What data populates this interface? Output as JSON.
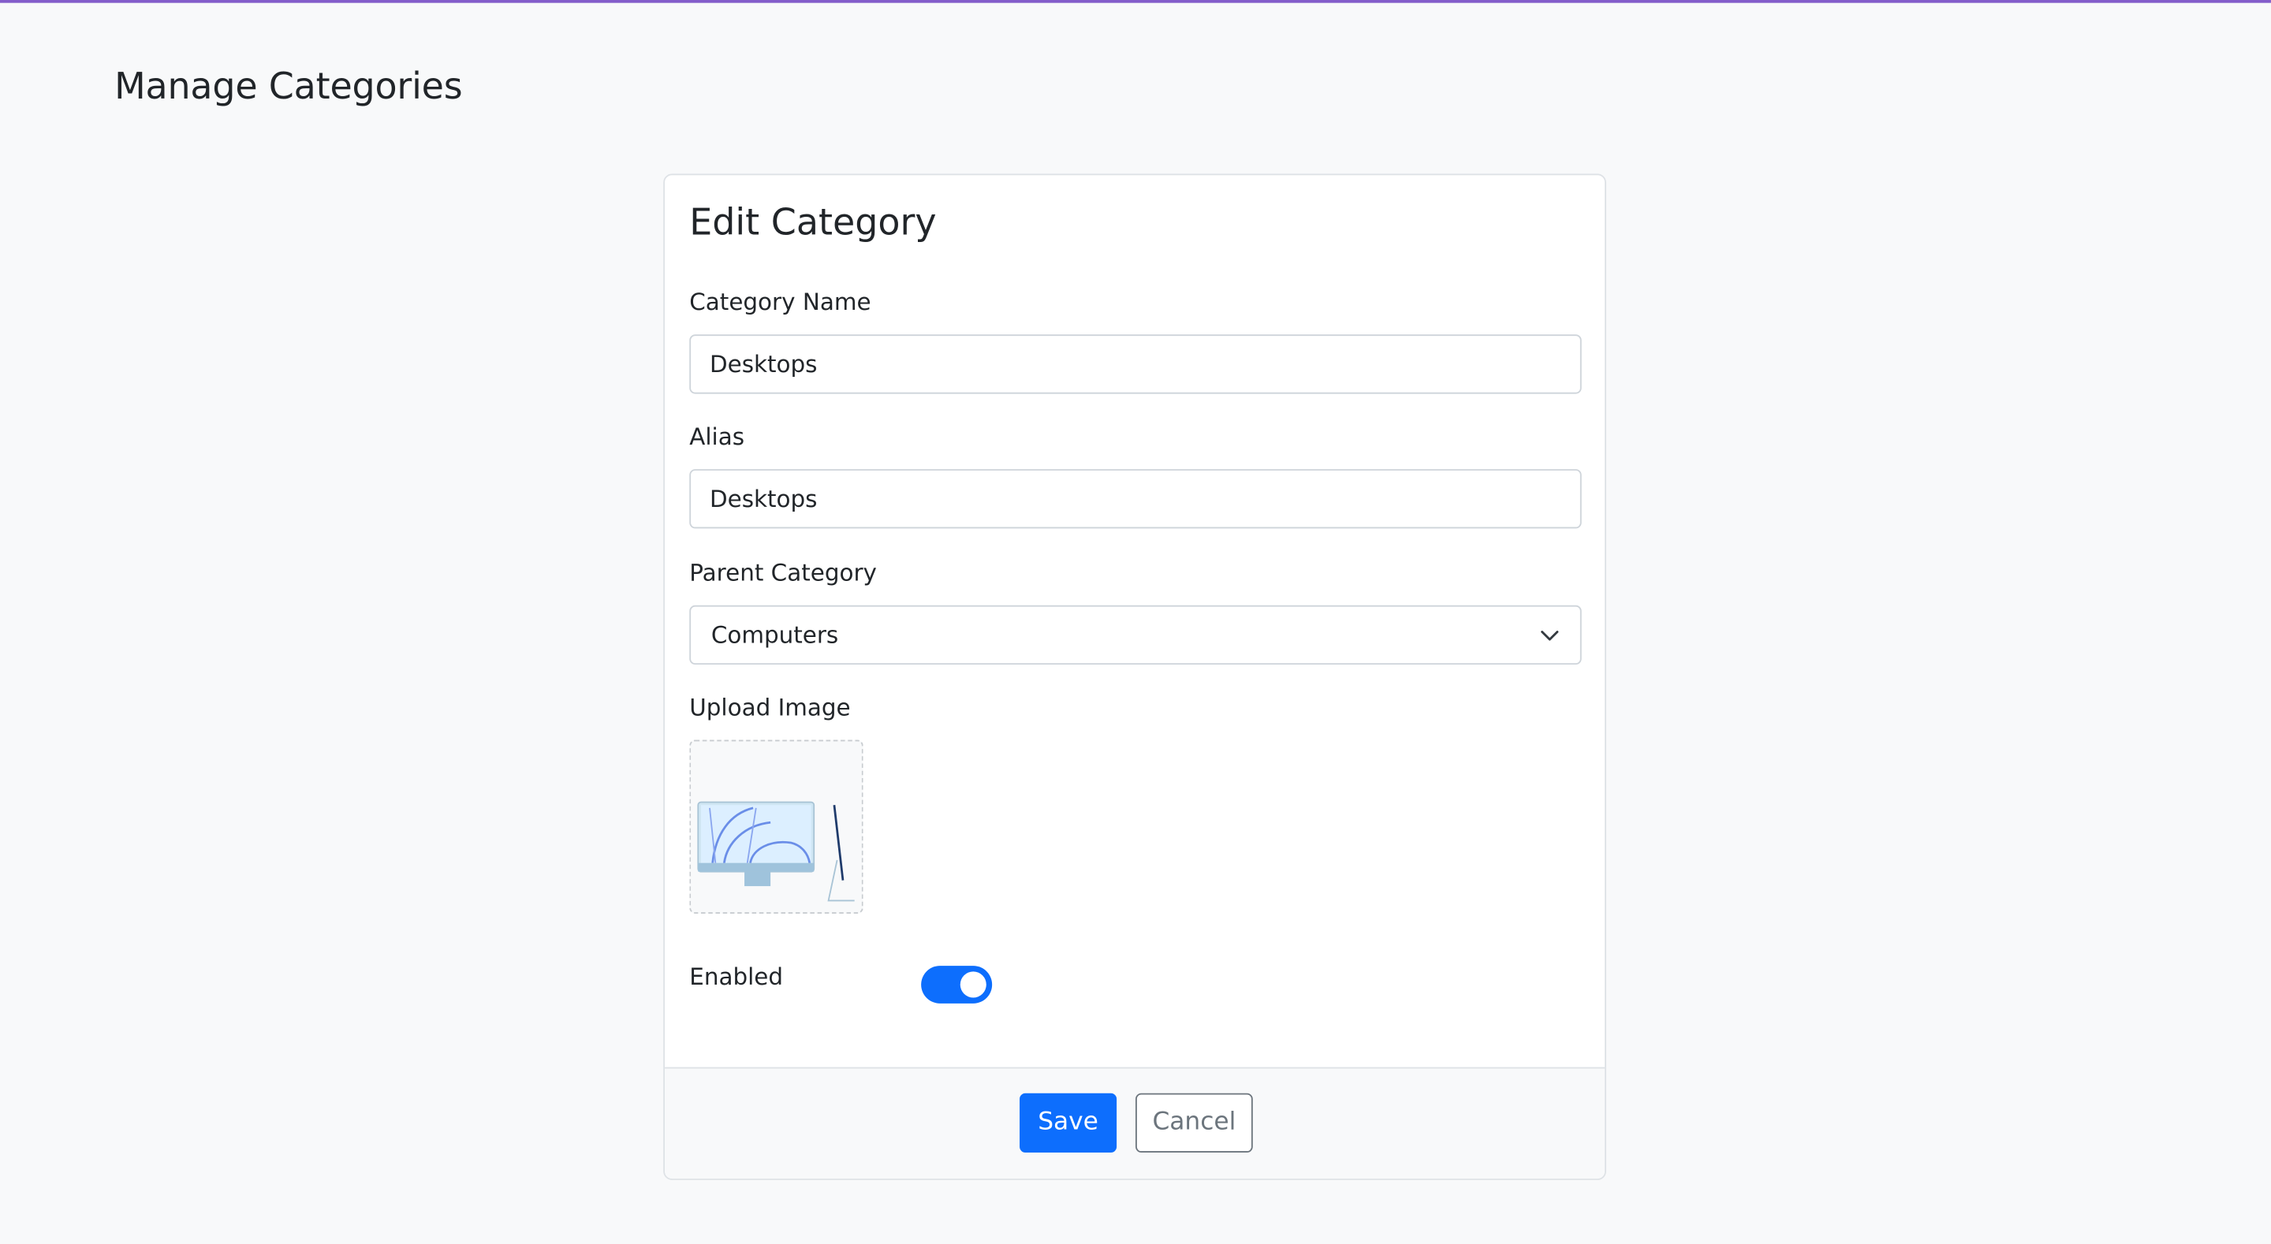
{
  "page": {
    "title": "Manage Categories"
  },
  "form": {
    "title": "Edit Category",
    "category_name": {
      "label": "Category Name",
      "value": "Desktops"
    },
    "alias": {
      "label": "Alias",
      "value": "Desktops"
    },
    "parent_category": {
      "label": "Parent Category",
      "selected": "Computers"
    },
    "upload_image": {
      "label": "Upload Image",
      "preview_icon": "desktop-computer-image"
    },
    "enabled": {
      "label": "Enabled",
      "checked": true
    },
    "buttons": {
      "save": "Save",
      "cancel": "Cancel"
    }
  },
  "colors": {
    "primary": "#0d6efd",
    "top_bar": "#6f42c1",
    "background": "#f8f9fa",
    "secondary": "#6c757d"
  }
}
